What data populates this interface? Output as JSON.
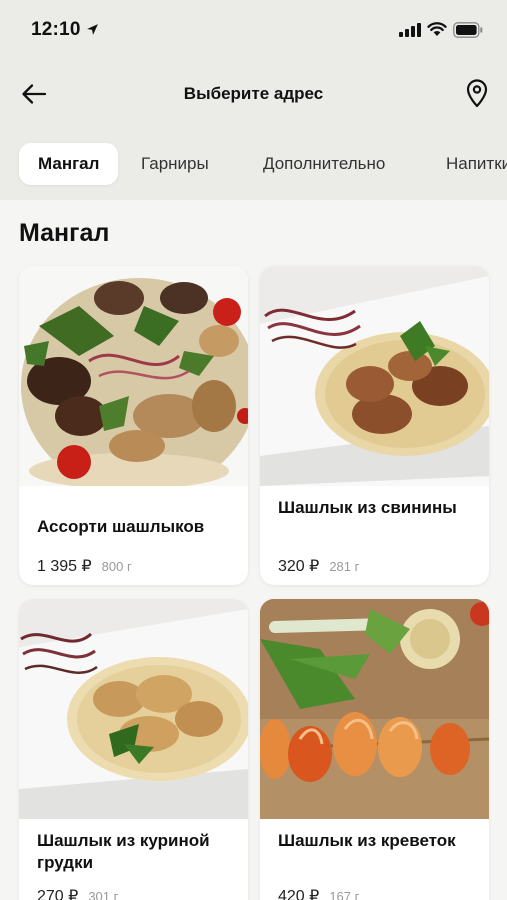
{
  "status_bar": {
    "time": "12:10"
  },
  "header": {
    "title": "Выберите адрес"
  },
  "tabs": [
    {
      "label": "Мангал",
      "active": true
    },
    {
      "label": "Гарниры",
      "active": false
    },
    {
      "label": "Дополнительно",
      "active": false
    },
    {
      "label": "Напитки",
      "active": false
    }
  ],
  "section": {
    "title": "Мангал"
  },
  "products": [
    {
      "name": "Ассорти шашлыков",
      "price": "1 395 ₽",
      "weight": "800 г"
    },
    {
      "name": "Шашлык из свинины",
      "price": "320 ₽",
      "weight": "281 г"
    },
    {
      "name": "Шашлык из куриной грудки",
      "price": "270 ₽",
      "weight": "301 г"
    },
    {
      "name": "Шашлык из креветок",
      "price": "420 ₽",
      "weight": "167 г"
    }
  ],
  "colors": {
    "header_bg": "#ebebe7",
    "card_bg": "#ffffff",
    "muted_text": "#9a9a9a"
  }
}
